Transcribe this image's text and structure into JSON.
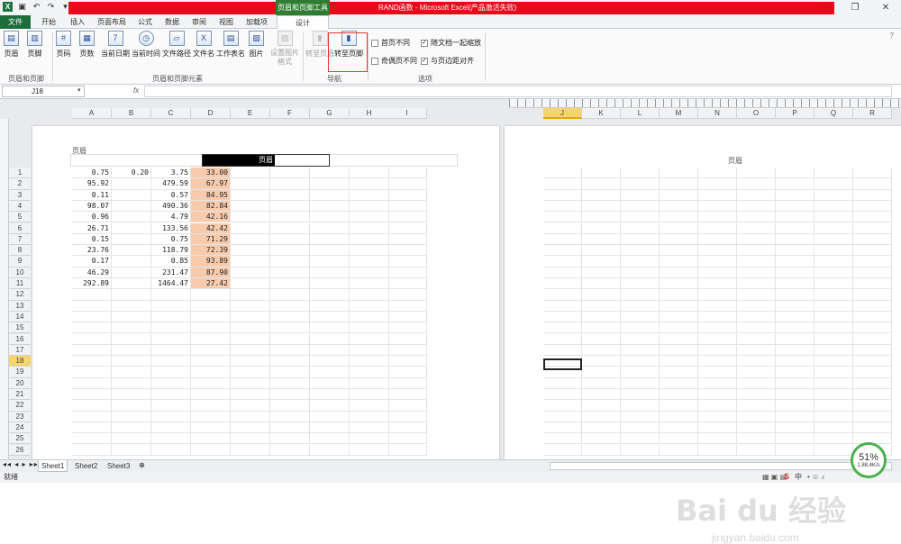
{
  "window": {
    "title": "RAND函数 - Microsoft Excel(产品激活失败)",
    "context_tab": "页眉和页脚工具"
  },
  "tabs": [
    "文件",
    "开始",
    "插入",
    "页面布局",
    "公式",
    "数据",
    "审阅",
    "视图",
    "加载项",
    "设计"
  ],
  "ribbon": {
    "group1": {
      "label": "页眉和页脚",
      "buttons": [
        "页眉",
        "页脚"
      ]
    },
    "group2": {
      "label": "页眉和页脚元素",
      "buttons": [
        "页码",
        "页数",
        "当前日期",
        "当前时间",
        "文件路径",
        "文件名",
        "工作表名",
        "图片",
        "设置图片格式"
      ]
    },
    "group3": {
      "label": "导航",
      "buttons": [
        "转至页眉",
        "转至页脚"
      ]
    },
    "group4": {
      "label": "选项",
      "checkboxes": [
        {
          "label": "首页不同",
          "checked": false
        },
        {
          "label": "奇偶页不同",
          "checked": false
        },
        {
          "label": "随文档一起缩放",
          "checked": true
        },
        {
          "label": "与页边距对齐",
          "checked": true
        }
      ]
    }
  },
  "formula_bar": {
    "name_box": "J18",
    "fx": "fx",
    "content": ""
  },
  "sheet": {
    "columns_left": [
      "A",
      "B",
      "C",
      "D",
      "E",
      "F",
      "G",
      "H",
      "I"
    ],
    "columns_right": [
      "J",
      "K",
      "L",
      "M",
      "N",
      "O",
      "P",
      "Q",
      "R"
    ],
    "selected_column": "J",
    "selected_row": "18",
    "header_label_small": "页眉",
    "header_edit_text": "页眉",
    "header_right_page": "页眉",
    "rows": [
      "1",
      "2",
      "3",
      "4",
      "5",
      "6",
      "7",
      "8",
      "9",
      "10",
      "11",
      "12",
      "13",
      "14",
      "15",
      "16",
      "17",
      "18",
      "19",
      "20",
      "21",
      "22",
      "23",
      "24",
      "25",
      "26"
    ],
    "data": [
      [
        "0.75",
        "0.20",
        "3.75",
        "33.00"
      ],
      [
        "95.92",
        "",
        "479.59",
        "67.97"
      ],
      [
        "0.11",
        "",
        "0.57",
        "84.95"
      ],
      [
        "98.07",
        "",
        "490.36",
        "82.84"
      ],
      [
        "0.96",
        "",
        "4.79",
        "42.16"
      ],
      [
        "26.71",
        "",
        "133.56",
        "42.42"
      ],
      [
        "0.15",
        "",
        "0.75",
        "71.29"
      ],
      [
        "23.76",
        "",
        "118.79",
        "72.39"
      ],
      [
        "0.17",
        "",
        "0.85",
        "93.89"
      ],
      [
        "46.29",
        "",
        "231.47",
        "87.90"
      ],
      [
        "292.89",
        "",
        "1464.47",
        "27.42"
      ]
    ]
  },
  "sheet_tabs": [
    "Sheet1",
    "Sheet2",
    "Sheet3"
  ],
  "status": {
    "ready": "就绪",
    "zoom": "51%",
    "speed": "1.88.4K/s"
  },
  "watermark": {
    "brand": "Bai du 经验",
    "url": "jingyan.baidu.com"
  },
  "colors": {
    "excel_green": "#1d6e3b",
    "title_red": "#e8091a",
    "highlight_cell": "#f8cbad"
  }
}
